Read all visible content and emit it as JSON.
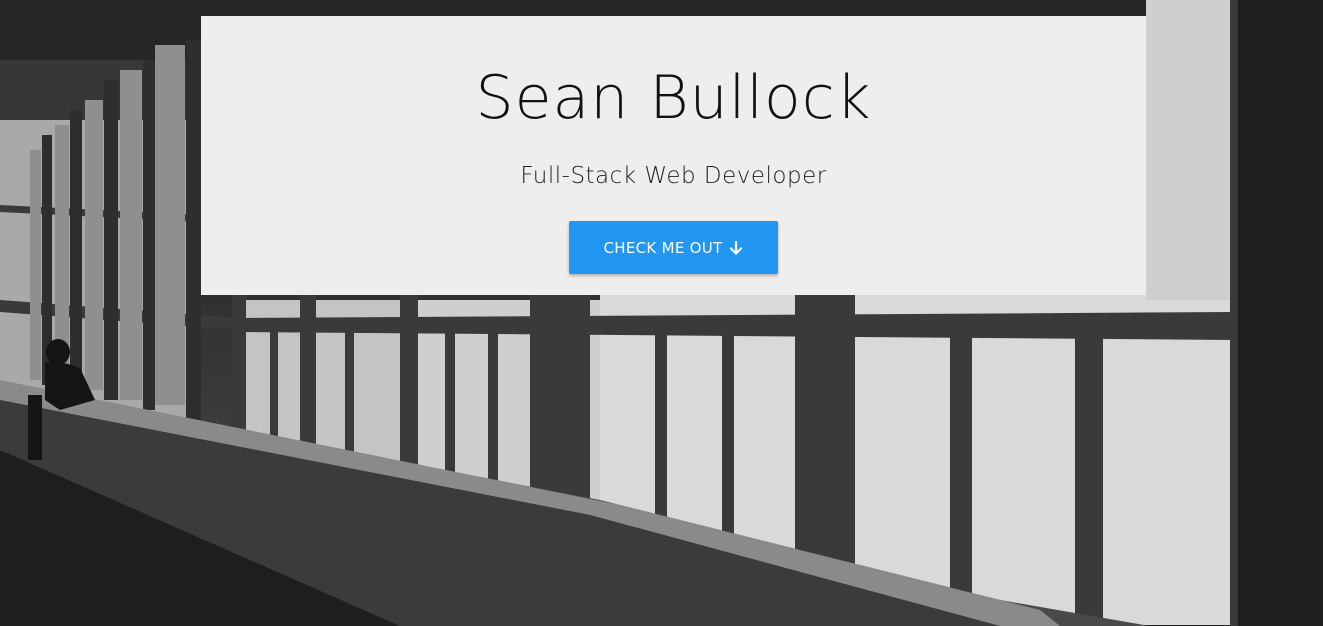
{
  "hero": {
    "name": "Sean Bullock",
    "role": "Full-Stack Web Developer",
    "cta_label": "CHECK ME OUT",
    "cta_icon": "arrow-down-icon"
  },
  "colors": {
    "card_background": "#eeeeee",
    "button": "#2196f3",
    "button_text": "#ffffff",
    "name_text": "#111111"
  }
}
